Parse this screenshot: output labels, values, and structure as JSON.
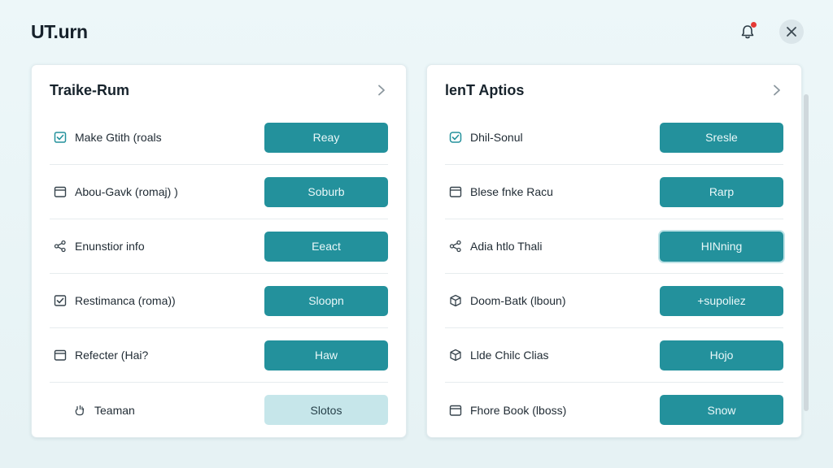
{
  "app": {
    "title": "UT.urn"
  },
  "header": {
    "bell_icon": "bell-icon",
    "close_icon": "close-icon",
    "accent": "#23919c",
    "badge_color": "#e53935"
  },
  "left_panel": {
    "title": "Traike-Rum",
    "rows": [
      {
        "icon": "checkbox-check-icon",
        "label": "Make Gtith (roals",
        "button": "Reay",
        "style": "primary"
      },
      {
        "icon": "calendar-icon",
        "label": "Abou-Gavk (romaj) )",
        "button": "Soburb",
        "style": "primary"
      },
      {
        "icon": "share-icon",
        "label": "Enunstior info",
        "button": "Eeact",
        "style": "primary"
      },
      {
        "icon": "checkbox-check-icon",
        "label": "Restimanca (roma))",
        "button": "Sloopn",
        "style": "primary"
      },
      {
        "icon": "calendar-icon",
        "label": "Refecter (Hai?",
        "button": "Haw",
        "style": "primary"
      },
      {
        "icon": "hand-icon",
        "label": "Teaman",
        "button": "Slotos",
        "style": "light"
      }
    ]
  },
  "right_panel": {
    "title": "lenT Aptios",
    "rows": [
      {
        "icon": "box-check-icon",
        "label": "Dhil-Sonul",
        "button": "Sresle",
        "style": "primary"
      },
      {
        "icon": "calendar-icon",
        "label": "Blese fnke Racu",
        "button": "Rarp",
        "style": "primary"
      },
      {
        "icon": "share-icon",
        "label": "Adia htlo Thali",
        "button": "HINning",
        "style": "outlined"
      },
      {
        "icon": "cube-icon",
        "label": "Doom-Batk (lboun)",
        "button": "+supoliez",
        "style": "primary"
      },
      {
        "icon": "cube-icon",
        "label": "Llde Chilc Clias",
        "button": "Hojo",
        "style": "primary"
      },
      {
        "icon": "calendar-icon",
        "label": "Fhore Book (lboss)",
        "button": "Snow",
        "style": "primary"
      }
    ]
  }
}
